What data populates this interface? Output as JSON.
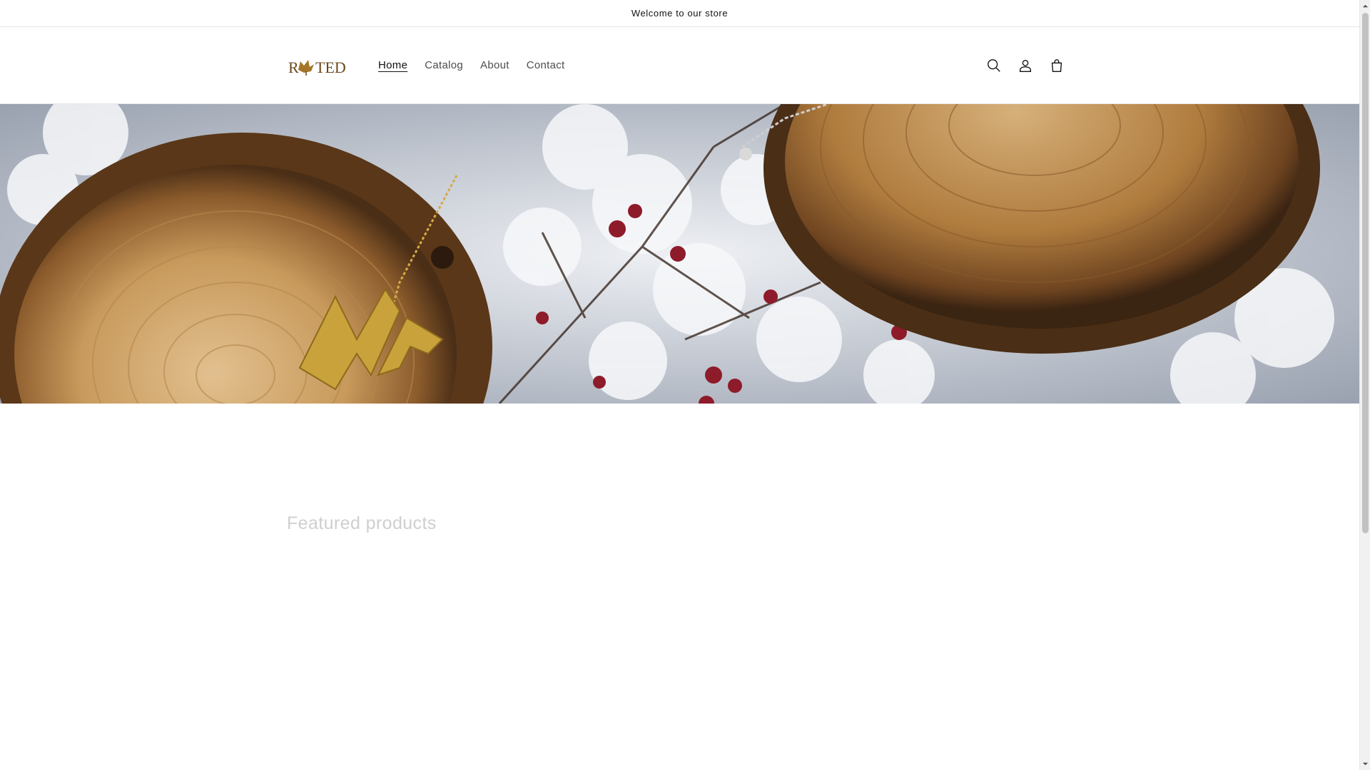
{
  "announcement": {
    "text": "Welcome to our store"
  },
  "header": {
    "logo_text": "ROOTED",
    "nav": [
      {
        "label": "Home",
        "active": true
      },
      {
        "label": "Catalog",
        "active": false
      },
      {
        "label": "About",
        "active": false
      },
      {
        "label": "Contact",
        "active": false
      }
    ],
    "icons": [
      "search-icon",
      "account-icon",
      "cart-icon"
    ]
  },
  "hero": {
    "image": "wood slices with gold pendant on snowy branches"
  },
  "featured": {
    "title": "Featured products"
  },
  "colors": {
    "text": "#121212",
    "muted": "#4d4d4d",
    "border": "#e6e6e6"
  }
}
